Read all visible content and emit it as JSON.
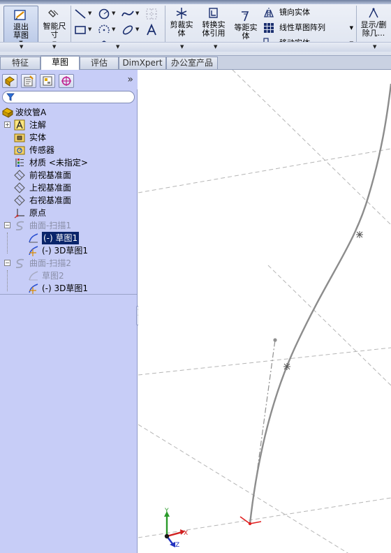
{
  "ribbon": {
    "exit_sketch": "退出草图",
    "smart_dimension": "智能尺寸",
    "trim_entities": "剪裁实体",
    "convert_entities": "转换实体引用",
    "offset_entities": "等距实体",
    "mirror_entities": "镜向实体",
    "linear_pattern": "线性草图阵列",
    "move_entities": "移动实体",
    "show_delete_relations": "显示/删除几..."
  },
  "tabs": [
    "特征",
    "草图",
    "评估",
    "DimXpert",
    "办公室产品"
  ],
  "active_tab": "草图",
  "tree": {
    "root": "波纹管A",
    "items": [
      {
        "label": "注解"
      },
      {
        "label": "实体"
      },
      {
        "label": "传感器"
      },
      {
        "label": "材质 <未指定>"
      },
      {
        "label": "前视基准面"
      },
      {
        "label": "上视基准面"
      },
      {
        "label": "右视基准面"
      },
      {
        "label": "原点"
      },
      {
        "label": "曲面-扫描1"
      },
      {
        "label": "(-) 草图1"
      },
      {
        "label": "(-) 3D草图1"
      },
      {
        "label": "曲面-扫描2"
      },
      {
        "label": "草图2"
      },
      {
        "label": "(-) 3D草图1"
      }
    ]
  },
  "triad": {
    "x": "X",
    "y": "Y",
    "z": "Z"
  },
  "colors": {
    "panel": "#c7cdf7",
    "selection": "#0a246a",
    "ribbon": "#dde3ef"
  }
}
